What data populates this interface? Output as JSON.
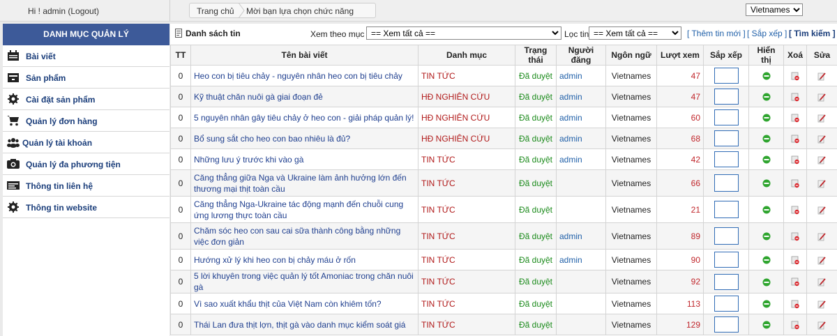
{
  "header": {
    "greeting": "Hi ! admin (Logout)",
    "breadcrumb_home": "Trang chủ",
    "breadcrumb_current": "Mời bạn lựa chọn chức năng",
    "language_selected": "Vietnames"
  },
  "sidebar": {
    "title": "DANH MỤC QUẢN LÝ",
    "items": [
      {
        "label": "Bài viết",
        "icon": "article-icon"
      },
      {
        "label": "Sản phẩm",
        "icon": "product-icon"
      },
      {
        "label": "Cài đặt sản phẩm",
        "icon": "gear-icon"
      },
      {
        "label": "Quản lý đơn hàng",
        "icon": "cart-icon"
      },
      {
        "label": "Quản lý tài khoản",
        "icon": "users-icon"
      },
      {
        "label": "Quản lý đa phương tiện",
        "icon": "camera-icon"
      },
      {
        "label": "Thông tin liên hệ",
        "icon": "contact-card-icon"
      },
      {
        "label": "Thông tin website",
        "icon": "gear-icon"
      }
    ]
  },
  "toolbar": {
    "list_title": "Danh sách tin",
    "filter_category_label": "Xem theo mục :",
    "filter_category_value": "== Xem tất cả ==",
    "filter_news_label": "Lọc tin",
    "filter_news_value": "== Xem tất cả ==",
    "add_link": "[ Thêm tin mới ]",
    "sort_link": "[ Sắp xếp ]",
    "search_link": "[ Tìm kiếm ]"
  },
  "table": {
    "headers": {
      "tt": "TT",
      "title": "Tên bài viết",
      "category": "Danh mục",
      "status": "Trạng thái",
      "author": "Người đăng",
      "language": "Ngôn ngữ",
      "views": "Lượt xem",
      "sort": "Sắp xếp",
      "visible": "Hiển thị",
      "delete": "Xoá",
      "edit": "Sửa"
    },
    "rows": [
      {
        "tt": "0",
        "title": "Heo con bị tiêu chảy - nguyên nhân heo con bị tiêu chảy",
        "category": "TIN TỨC",
        "status": "Đã duyệt",
        "author": "admin",
        "language": "Vietnames",
        "views": "47"
      },
      {
        "tt": "0",
        "title": "Kỹ thuật chăn nuôi gà giai đoạn đẻ",
        "category": "HĐ NGHIÊN CỨU",
        "status": "Đã duyệt",
        "author": "admin",
        "language": "Vietnames",
        "views": "47"
      },
      {
        "tt": "0",
        "title": "5 nguyên nhân gây tiêu chảy ở heo con - giải pháp quản lý!",
        "category": "HĐ NGHIÊN CỨU",
        "status": "Đã duyệt",
        "author": "admin",
        "language": "Vietnames",
        "views": "60"
      },
      {
        "tt": "0",
        "title": "Bổ sung sắt cho heo con bao nhiêu là đủ?",
        "category": "HĐ NGHIÊN CỨU",
        "status": "Đã duyệt",
        "author": "admin",
        "language": "Vietnames",
        "views": "68"
      },
      {
        "tt": "0",
        "title": "Những lưu ý trước khi vào gà",
        "category": "TIN TỨC",
        "status": "Đã duyệt",
        "author": "admin",
        "language": "Vietnames",
        "views": "42"
      },
      {
        "tt": "0",
        "title": "Căng thẳng giữa Nga và Ukraine làm ảnh hưởng lớn đến thương mại thịt toàn cầu",
        "category": "TIN TỨC",
        "status": "Đã duyệt",
        "author": "",
        "language": "Vietnames",
        "views": "66"
      },
      {
        "tt": "0",
        "title": "Căng thẳng Nga-Ukraine tác động mạnh đến chuỗi cung ứng lương thực toàn cầu",
        "category": "TIN TỨC",
        "status": "Đã duyệt",
        "author": "",
        "language": "Vietnames",
        "views": "21"
      },
      {
        "tt": "0",
        "title": "Chăm sóc heo con sau cai sữa thành công bằng những việc đơn giản",
        "category": "TIN TỨC",
        "status": "Đã duyệt",
        "author": "admin",
        "language": "Vietnames",
        "views": "89"
      },
      {
        "tt": "0",
        "title": "Hướng xử lý khi heo con bị chảy máu ở rốn",
        "category": "TIN TỨC",
        "status": "Đã duyệt",
        "author": "admin",
        "language": "Vietnames",
        "views": "90"
      },
      {
        "tt": "0",
        "title": "5 lời khuyên trong việc quản lý tốt Amoniac trong chăn nuôi gà",
        "category": "TIN TỨC",
        "status": "Đã duyệt",
        "author": "",
        "language": "Vietnames",
        "views": "92"
      },
      {
        "tt": "0",
        "title": "Vì sao xuất khẩu thịt của Việt Nam còn khiêm tốn?",
        "category": "TIN TỨC",
        "status": "Đã duyệt",
        "author": "",
        "language": "Vietnames",
        "views": "113"
      },
      {
        "tt": "0",
        "title": "Thái Lan đưa thịt lợn, thịt gà vào danh mục kiểm soát giá",
        "category": "TIN TỨC",
        "status": "Đã duyệt",
        "author": "",
        "language": "Vietnames",
        "views": "129"
      }
    ]
  },
  "colors": {
    "sidebar_title_bg": "#3d5a99",
    "link_blue": "#1f3f8f",
    "category_red": "#b01818",
    "status_green": "#1a8a1a",
    "views_red": "#c0262b"
  }
}
